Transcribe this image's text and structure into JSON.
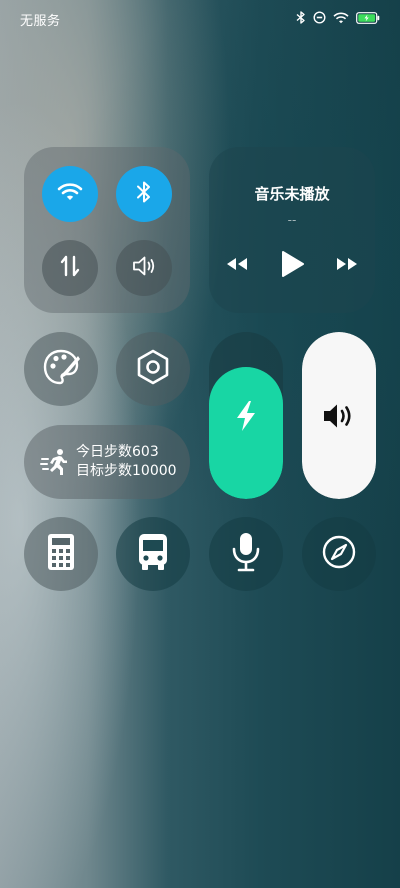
{
  "status_bar": {
    "carrier": "无服务",
    "icons": [
      "bluetooth-icon",
      "do-not-disturb-icon",
      "wifi-icon",
      "battery-charging-icon"
    ]
  },
  "connectivity": {
    "toggles": [
      {
        "name": "wifi",
        "icon": "wifi-icon",
        "active": true
      },
      {
        "name": "bluetooth",
        "icon": "bluetooth-icon",
        "active": true
      },
      {
        "name": "mobile-data",
        "icon": "data-arrows-icon",
        "active": false
      },
      {
        "name": "sound",
        "icon": "speaker-icon",
        "active": false
      }
    ],
    "accent": "#1aa7e9"
  },
  "music": {
    "title": "音乐未播放",
    "subtitle": "--",
    "controls": [
      "previous-icon",
      "play-icon",
      "next-icon"
    ]
  },
  "quick_buttons": [
    {
      "name": "theme",
      "icon": "palette-icon"
    },
    {
      "name": "settings",
      "icon": "hexagon-settings-icon"
    }
  ],
  "steps": {
    "today": "今日步数603",
    "goal": "目标步数10000",
    "icon": "running-icon"
  },
  "sliders": {
    "brightness": {
      "icon": "flash-icon",
      "level": 0.79,
      "color": "#18d6a4"
    },
    "volume": {
      "icon": "volume-icon",
      "level": 1.0,
      "color": "#f7f7f7"
    }
  },
  "shortcuts": [
    {
      "name": "calculator",
      "icon": "calculator-icon"
    },
    {
      "name": "bus",
      "icon": "bus-icon"
    },
    {
      "name": "voice",
      "icon": "microphone-icon"
    },
    {
      "name": "compass",
      "icon": "compass-icon"
    }
  ]
}
